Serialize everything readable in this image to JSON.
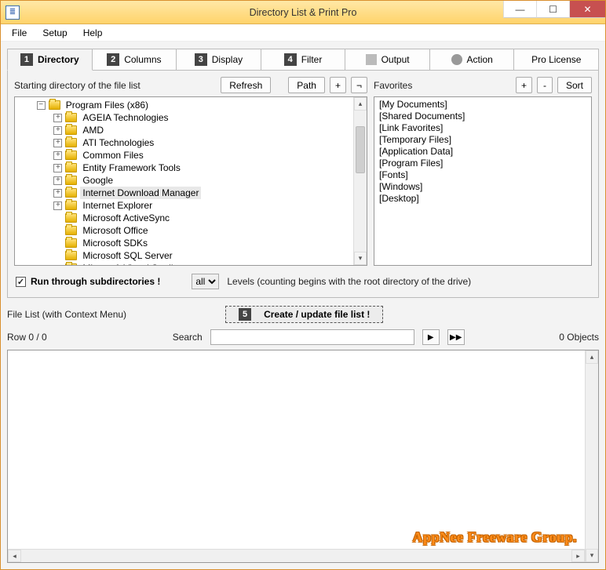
{
  "window": {
    "title": "Directory List & Print Pro"
  },
  "menu": {
    "file": "File",
    "setup": "Setup",
    "help": "Help"
  },
  "tabs": {
    "directory": "Directory",
    "columns": "Columns",
    "display": "Display",
    "filter": "Filter",
    "output": "Output",
    "action": "Action",
    "pro": "Pro License"
  },
  "panel": {
    "startLabel": "Starting directory of the file list",
    "refresh": "Refresh",
    "path": "Path",
    "plus": "+",
    "neg": "¬",
    "favoritesLabel": "Favorites",
    "favPlus": "+",
    "favMinus": "-",
    "favSort": "Sort"
  },
  "tree": {
    "root": "Program Files (x86)",
    "children": [
      "AGEIA Technologies",
      "AMD",
      "ATI Technologies",
      "Common Files",
      "Entity Framework Tools",
      "Google",
      "Internet Download Manager",
      "Internet Explorer",
      "Microsoft ActiveSync",
      "Microsoft Office",
      "Microsoft SDKs",
      "Microsoft SQL Server",
      "Microsoft Visual Studio"
    ],
    "selectedIndex": 6
  },
  "favorites": [
    "[My Documents]",
    "[Shared Documents]",
    "[Link Favorites]",
    "[Temporary Files]",
    "[Application Data]",
    "[Program Files]",
    "[Fonts]",
    "[Windows]",
    "[Desktop]"
  ],
  "subdir": {
    "label": "Run through subdirectories !",
    "levelsSel": "all",
    "levelsText": "Levels  (counting begins with the root directory of the drive)"
  },
  "filelist": {
    "heading": "File List (with Context Menu)",
    "createLabel": "Create / update file list !",
    "rowLabel": "Row 0 / 0",
    "searchLabel": "Search",
    "objects": "0 Objects"
  },
  "watermark": "AppNee Freeware Group."
}
